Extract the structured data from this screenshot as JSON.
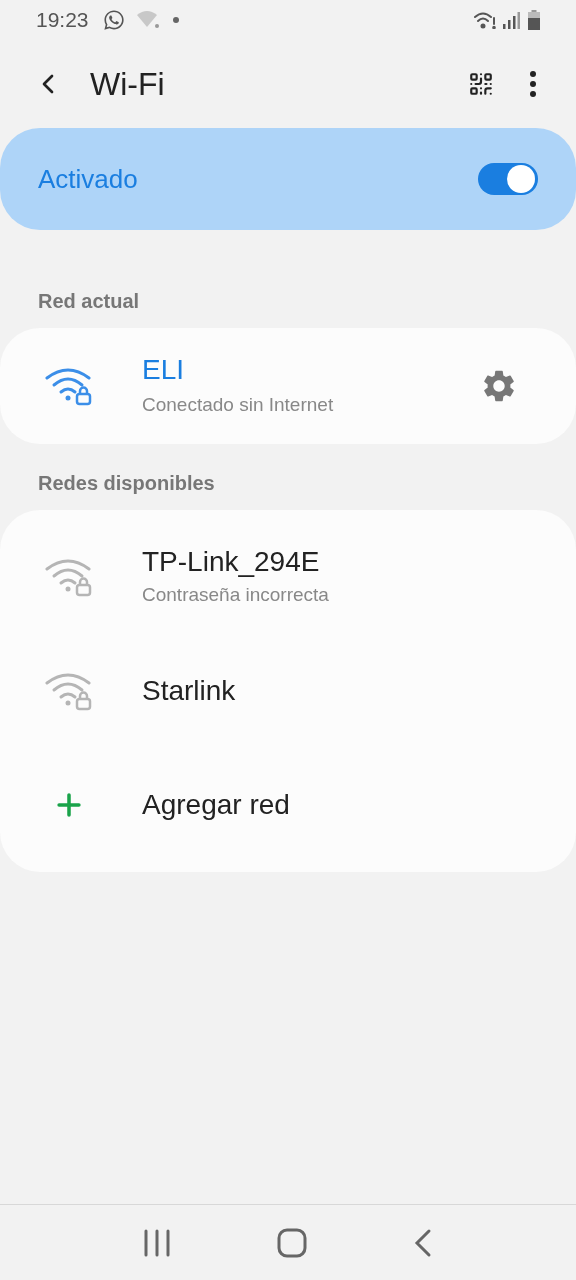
{
  "status_bar": {
    "time": "19:23"
  },
  "header": {
    "title": "Wi-Fi"
  },
  "master_switch": {
    "label": "Activado",
    "on": true
  },
  "current_section": {
    "heading": "Red actual",
    "network": {
      "name": "ELI",
      "status": "Conectado sin Internet"
    }
  },
  "available_section": {
    "heading": "Redes disponibles",
    "items": [
      {
        "kind": "network",
        "name": "TP-Link_294E",
        "status": "Contraseña incorrecta"
      },
      {
        "kind": "network",
        "name": "Starlink"
      },
      {
        "kind": "add",
        "name": "Agregar red"
      }
    ]
  }
}
